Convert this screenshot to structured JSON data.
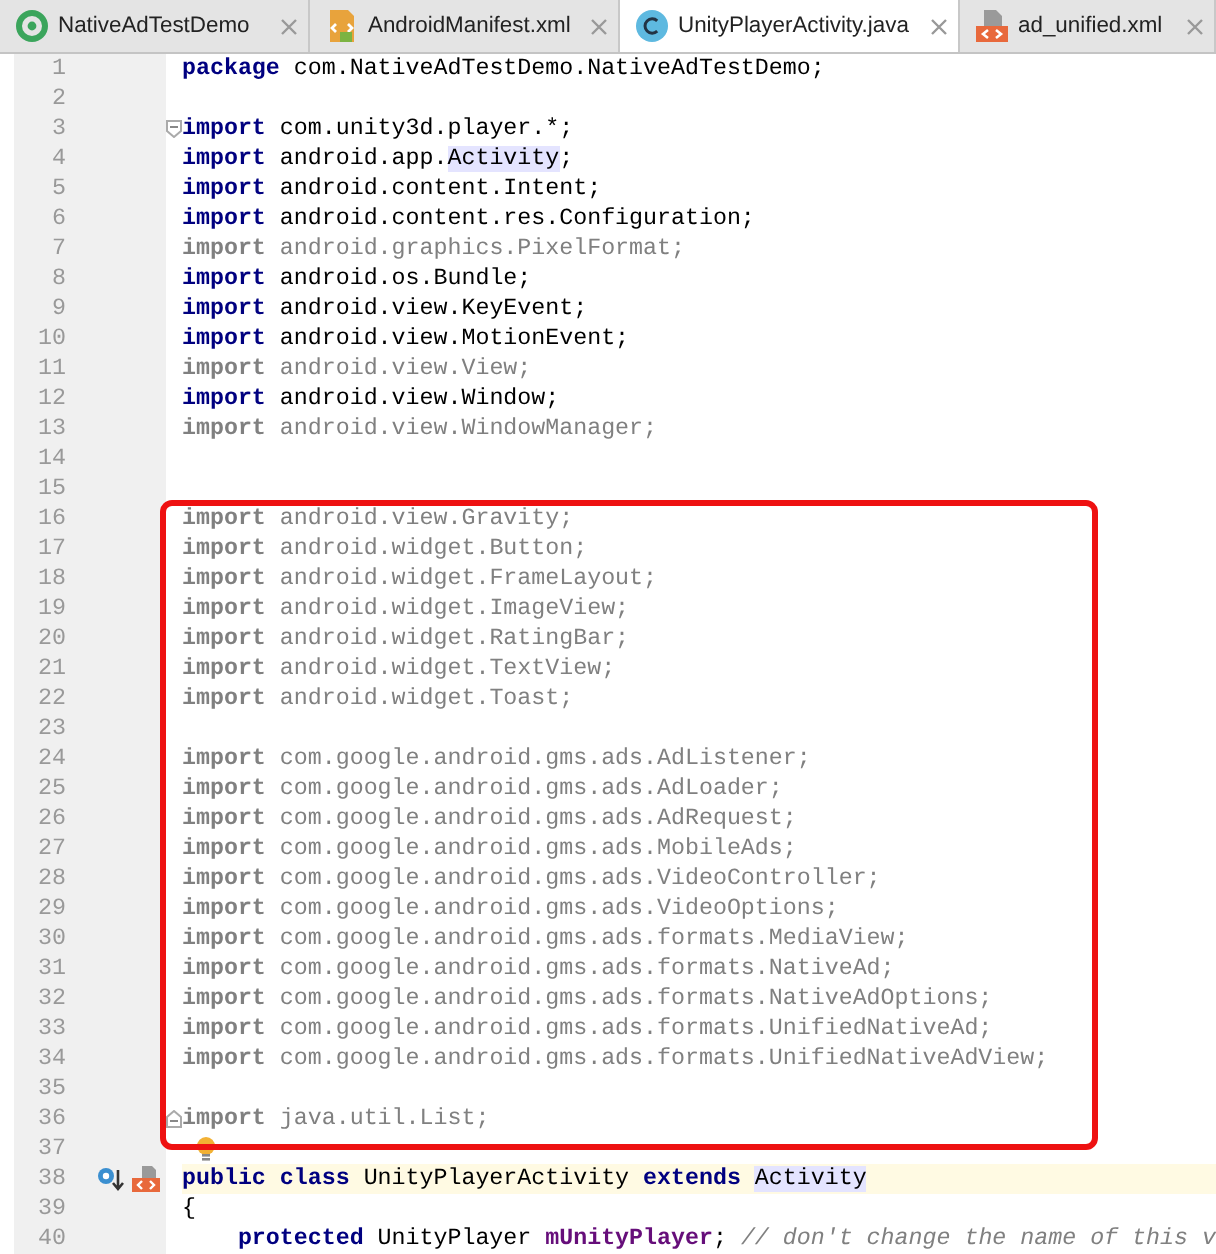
{
  "tabs": [
    {
      "label": "NativeAdTestDemo",
      "selected": false
    },
    {
      "label": "AndroidManifest.xml",
      "selected": false
    },
    {
      "label": "UnityPlayerActivity.java",
      "selected": true
    },
    {
      "label": "ad_unified.xml",
      "selected": false
    }
  ],
  "sections": [
    {
      "boxed": false,
      "lines": [
        {
          "n": "1",
          "code": [
            {
              "kind": "keyword",
              "text": "package"
            },
            {
              "kind": "plain",
              "text": " com.NativeAdTestDemo.NativeAdTestDemo;"
            }
          ]
        },
        {
          "n": "2"
        },
        {
          "n": "3",
          "fold_open": true,
          "code": [
            {
              "kind": "keyword",
              "text": "import"
            },
            {
              "kind": "plain",
              "text": " com.unity3d.player.*;"
            }
          ]
        },
        {
          "n": "4",
          "code": [
            {
              "kind": "keyword",
              "text": "import"
            },
            {
              "kind": "plain",
              "text": " android.app."
            },
            {
              "kind": "ref",
              "text": "Activity"
            },
            {
              "kind": "plain",
              "text": ";"
            }
          ]
        },
        {
          "n": "5",
          "code": [
            {
              "kind": "keyword",
              "text": "import"
            },
            {
              "kind": "plain",
              "text": " android.content.Intent;"
            }
          ]
        },
        {
          "n": "6",
          "code": [
            {
              "kind": "keyword",
              "text": "import"
            },
            {
              "kind": "plain",
              "text": " android.content.res.Configuration;"
            }
          ]
        },
        {
          "n": "7",
          "code": [
            {
              "kind": "unused_keyword",
              "text": "import"
            },
            {
              "kind": "unused",
              "text": " android.graphics.PixelFormat;"
            }
          ]
        },
        {
          "n": "8",
          "code": [
            {
              "kind": "keyword",
              "text": "import"
            },
            {
              "kind": "plain",
              "text": " android.os.Bundle;"
            }
          ]
        },
        {
          "n": "9",
          "code": [
            {
              "kind": "keyword",
              "text": "import"
            },
            {
              "kind": "plain",
              "text": " android.view.KeyEvent;"
            }
          ]
        },
        {
          "n": "10",
          "code": [
            {
              "kind": "keyword",
              "text": "import"
            },
            {
              "kind": "plain",
              "text": " android.view.MotionEvent;"
            }
          ]
        },
        {
          "n": "11",
          "code": [
            {
              "kind": "unused_keyword",
              "text": "import"
            },
            {
              "kind": "unused",
              "text": " android.view.View;"
            }
          ]
        },
        {
          "n": "12",
          "code": [
            {
              "kind": "keyword",
              "text": "import"
            },
            {
              "kind": "plain",
              "text": " android.view.Window;"
            }
          ]
        },
        {
          "n": "13",
          "code": [
            {
              "kind": "unused_keyword",
              "text": "import"
            },
            {
              "kind": "unused",
              "text": " android.view.WindowManager;"
            }
          ]
        },
        {
          "n": "14"
        },
        {
          "n": "15"
        }
      ]
    },
    {
      "boxed": true,
      "lines": [
        {
          "n": "16",
          "code": [
            {
              "kind": "unused_keyword",
              "text": "import"
            },
            {
              "kind": "unused",
              "text": " android.view.Gravity;"
            }
          ]
        },
        {
          "n": "17",
          "code": [
            {
              "kind": "unused_keyword",
              "text": "import"
            },
            {
              "kind": "unused",
              "text": " android.widget.Button;"
            }
          ]
        },
        {
          "n": "18",
          "code": [
            {
              "kind": "unused_keyword",
              "text": "import"
            },
            {
              "kind": "unused",
              "text": " android.widget.FrameLayout;"
            }
          ]
        },
        {
          "n": "19",
          "code": [
            {
              "kind": "unused_keyword",
              "text": "import"
            },
            {
              "kind": "unused",
              "text": " android.widget.ImageView;"
            }
          ]
        },
        {
          "n": "20",
          "code": [
            {
              "kind": "unused_keyword",
              "text": "import"
            },
            {
              "kind": "unused",
              "text": " android.widget.RatingBar;"
            }
          ]
        },
        {
          "n": "21",
          "code": [
            {
              "kind": "unused_keyword",
              "text": "import"
            },
            {
              "kind": "unused",
              "text": " android.widget.TextView;"
            }
          ]
        },
        {
          "n": "22",
          "code": [
            {
              "kind": "unused_keyword",
              "text": "import"
            },
            {
              "kind": "unused",
              "text": " android.widget.Toast;"
            }
          ]
        },
        {
          "n": "23"
        },
        {
          "n": "24",
          "code": [
            {
              "kind": "unused_keyword",
              "text": "import"
            },
            {
              "kind": "unused",
              "text": " com.google.android.gms.ads.AdListener;"
            }
          ]
        },
        {
          "n": "25",
          "code": [
            {
              "kind": "unused_keyword",
              "text": "import"
            },
            {
              "kind": "unused",
              "text": " com.google.android.gms.ads.AdLoader;"
            }
          ]
        },
        {
          "n": "26",
          "code": [
            {
              "kind": "unused_keyword",
              "text": "import"
            },
            {
              "kind": "unused",
              "text": " com.google.android.gms.ads.AdRequest;"
            }
          ]
        },
        {
          "n": "27",
          "code": [
            {
              "kind": "unused_keyword",
              "text": "import"
            },
            {
              "kind": "unused",
              "text": " com.google.android.gms.ads.MobileAds;"
            }
          ]
        },
        {
          "n": "28",
          "code": [
            {
              "kind": "unused_keyword",
              "text": "import"
            },
            {
              "kind": "unused",
              "text": " com.google.android.gms.ads.VideoController;"
            }
          ]
        },
        {
          "n": "29",
          "code": [
            {
              "kind": "unused_keyword",
              "text": "import"
            },
            {
              "kind": "unused",
              "text": " com.google.android.gms.ads.VideoOptions;"
            }
          ]
        },
        {
          "n": "30",
          "code": [
            {
              "kind": "unused_keyword",
              "text": "import"
            },
            {
              "kind": "unused",
              "text": " com.google.android.gms.ads.formats.MediaView;"
            }
          ]
        },
        {
          "n": "31",
          "code": [
            {
              "kind": "unused_keyword",
              "text": "import"
            },
            {
              "kind": "unused",
              "text": " com.google.android.gms.ads.formats.NativeAd;"
            }
          ]
        },
        {
          "n": "32",
          "code": [
            {
              "kind": "unused_keyword",
              "text": "import"
            },
            {
              "kind": "unused",
              "text": " com.google.android.gms.ads.formats.NativeAdOptions;"
            }
          ]
        },
        {
          "n": "33",
          "code": [
            {
              "kind": "unused_keyword",
              "text": "import"
            },
            {
              "kind": "unused",
              "text": " com.google.android.gms.ads.formats.UnifiedNativeAd;"
            }
          ]
        },
        {
          "n": "34",
          "code": [
            {
              "kind": "unused_keyword",
              "text": "import"
            },
            {
              "kind": "unused",
              "text": " com.google.android.gms.ads.formats.UnifiedNativeAdView;"
            }
          ]
        },
        {
          "n": "35"
        },
        {
          "n": "36",
          "fold_close": true,
          "code": [
            {
              "kind": "unused_keyword",
              "text": "import"
            },
            {
              "kind": "unused",
              "text": " java.util.List;"
            }
          ]
        },
        {
          "n": "37",
          "bulb": true
        }
      ]
    },
    {
      "boxed": false,
      "lines": [
        {
          "n": "38",
          "current": true,
          "implemented": true,
          "has_layout": true,
          "code": [
            {
              "kind": "keyword",
              "text": "public class"
            },
            {
              "kind": "plain",
              "text": " UnityPlayerActivity "
            },
            {
              "kind": "keyword",
              "text": "extends "
            },
            {
              "kind": "ref",
              "text": "Activity"
            }
          ]
        },
        {
          "n": "39",
          "code": [
            {
              "kind": "plain",
              "text": "{"
            }
          ]
        },
        {
          "n": "40",
          "code": [
            {
              "kind": "keyword",
              "text": "    protected"
            },
            {
              "kind": "plain",
              "text": " UnityPlayer "
            },
            {
              "kind": "field",
              "text": "mUnityPlayer"
            },
            {
              "kind": "plain",
              "text": "; "
            },
            {
              "kind": "comment",
              "text": "// don't change the name of this v"
            }
          ]
        }
      ]
    }
  ]
}
